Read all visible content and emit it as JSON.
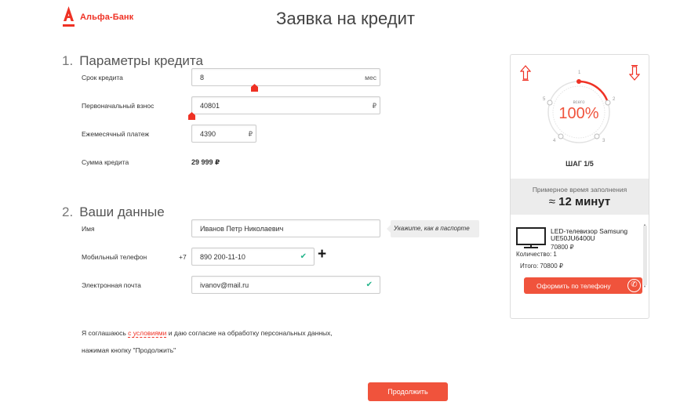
{
  "header": {
    "logo_text": "Альфа-Банк",
    "page_title": "Заявка на кредит"
  },
  "section1": {
    "number": "1.",
    "title": "Параметры кредита",
    "term_label": "Срок кредита",
    "term_value": "8",
    "term_suffix": "мес",
    "down_label": "Первоначальный взнос",
    "down_value": "40801",
    "currency_symbol": "₽",
    "monthly_label": "Ежемесячный платеж",
    "monthly_value": "4390",
    "sum_label": "Сумма кредита",
    "sum_value": "29 999 ₽"
  },
  "section2": {
    "number": "2.",
    "title": "Ваши данные",
    "name_label": "Имя",
    "name_value": "Иванов Петр Николаевич",
    "name_tooltip": "Укажите, как в паспорте",
    "phone_label": "Мобильный телефон",
    "phone_prefix": "+7",
    "phone_value": "890 200-11-10",
    "email_label": "Электронная почта",
    "email_value": "ivanov@mail.ru",
    "add_symbol": "+"
  },
  "agreement": {
    "line1_before": "Я соглашаюсь ",
    "line1_link": "с условиями",
    "line1_after": " и даю согласие на обработку персональных данных,",
    "line2": "нажимая кнопку \"Продолжить\""
  },
  "continue_button": "Продолжить",
  "panel": {
    "progress_caption": "всего",
    "progress_value": "100%",
    "progress_fraction": 1.0,
    "step_numbers": [
      "1",
      "2",
      "3",
      "4",
      "5"
    ],
    "step_label": "ШАГ 1/5",
    "time_caption": "Примерное время заполнения",
    "time_approx": "≈",
    "time_value": "12 минут",
    "product_name": "LED-телевизор Samsung UE50JU6400U",
    "product_price": "70800 ₽",
    "quantity": "Количество: 1",
    "total": "Итого: 70800 ₽",
    "phone_order_button": "Оформить по телефону"
  },
  "colors": {
    "brand": "#ef3124",
    "button": "#f0533c",
    "check": "#23b48a"
  }
}
